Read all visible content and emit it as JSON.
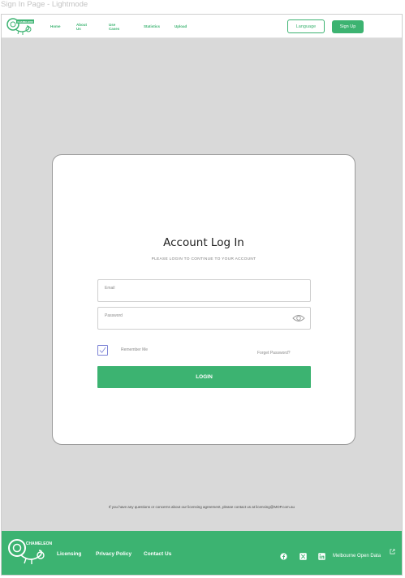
{
  "page": {
    "caption": "Sign In Page - Lightmode"
  },
  "header": {
    "logo_text": "CHAMELEON",
    "nav": [
      "Home",
      "About Us",
      "Use Cases",
      "Statistics",
      "Upload"
    ],
    "language_label": "Language",
    "signup_label": "Sign Up"
  },
  "login": {
    "title": "Account Log In",
    "subtitle": "PLEASE LOGIN TO CONTINUE TO YOUR ACCOUNT",
    "email_placeholder": "Email",
    "password_placeholder": "Password",
    "remember_label": "Remember Me",
    "remember_checked": true,
    "forgot_label": "Forget Password?",
    "login_label": "LOGIN"
  },
  "notice": "If you have any questions or concerns about our licensing agreement, please contact us at licensing@MOP.com.au",
  "footer": {
    "logo_text": "CHAMELEON",
    "links": [
      "Licensing",
      "Privacy Policy",
      "Contact Us"
    ],
    "social": [
      "facebook-icon",
      "x-icon",
      "linkedin-icon"
    ],
    "open_data_label": "Melbourne Open Data"
  },
  "colors": {
    "accent": "#3cb371",
    "background": "#d9d9d9",
    "card": "#ffffff"
  }
}
